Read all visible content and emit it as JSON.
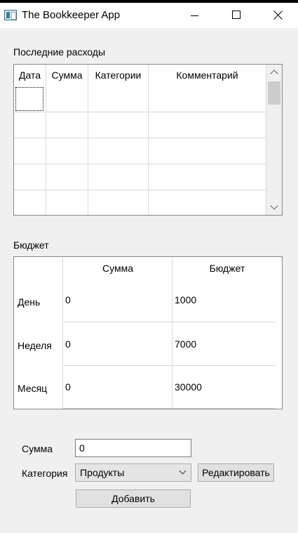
{
  "window": {
    "title": "The Bookkeeper App"
  },
  "expenses": {
    "section_label": "Последние расходы",
    "columns": [
      "Дата",
      "Сумма",
      "Категории",
      "Комментарий"
    ]
  },
  "budget": {
    "section_label": "Бюджет",
    "columns": [
      "Сумма",
      "Бюджет"
    ],
    "rows": [
      {
        "label": "День",
        "sum": "0",
        "budget": "1000"
      },
      {
        "label": "Неделя",
        "sum": "0",
        "budget": "7000"
      },
      {
        "label": "Месяц",
        "sum": "0",
        "budget": "30000"
      }
    ]
  },
  "form": {
    "amount_label": "Сумма",
    "amount_value": "0",
    "category_label": "Категория",
    "category_selected": "Продукты",
    "edit_button": "Редактировать",
    "add_button": "Добавить"
  }
}
